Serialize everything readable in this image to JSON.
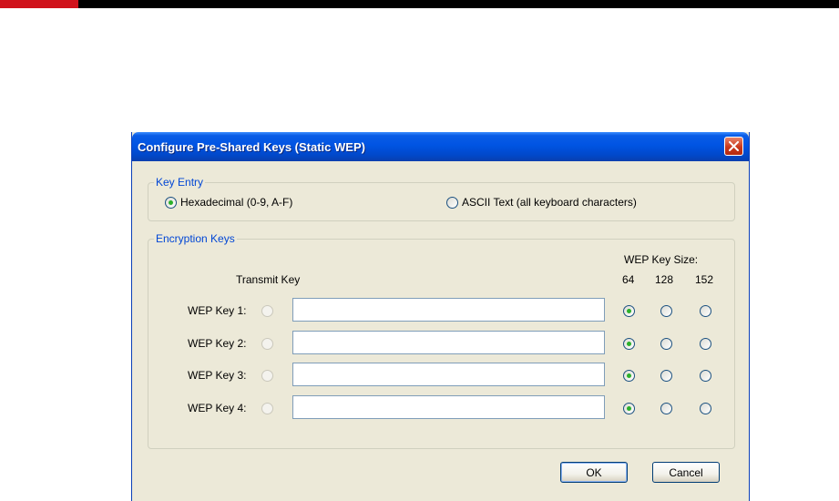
{
  "dialog": {
    "title": "Configure Pre-Shared Keys (Static WEP)"
  },
  "key_entry": {
    "legend": "Key Entry",
    "options": [
      {
        "label": "Hexadecimal (0-9, A-F)",
        "selected": true
      },
      {
        "label": "ASCII Text (all keyboard characters)",
        "selected": false
      }
    ]
  },
  "encryption_keys": {
    "legend": "Encryption Keys",
    "transmit_key_header": "Transmit Key",
    "size_header": "WEP Key Size:",
    "size_options": [
      "64",
      "128",
      "152"
    ],
    "keys": [
      {
        "label": "WEP Key 1:",
        "value": "",
        "selected_size": "64"
      },
      {
        "label": "WEP Key 2:",
        "value": "",
        "selected_size": "64"
      },
      {
        "label": "WEP Key 3:",
        "value": "",
        "selected_size": "64"
      },
      {
        "label": "WEP Key 4:",
        "value": "",
        "selected_size": "64"
      }
    ]
  },
  "buttons": {
    "ok": "OK",
    "cancel": "Cancel"
  },
  "colors": {
    "titlebar": "#0054e3",
    "dialog_bg": "#ece9d8",
    "legend_text": "#0046d5",
    "radio_checked": "#2bb02b",
    "top_accent": "#d0121b"
  },
  "icons": {
    "close": "close-x-icon"
  }
}
